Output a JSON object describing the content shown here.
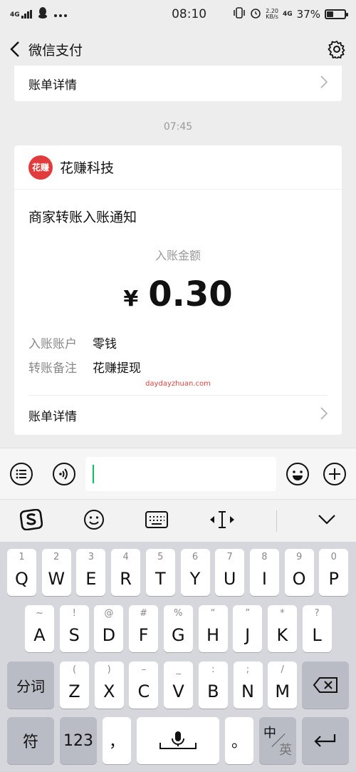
{
  "status_bar": {
    "network": "4G",
    "time": "08:10",
    "speed_top": "2.20",
    "speed_bottom": "KB/s",
    "network_right": "4G",
    "battery": "37%",
    "battery_level": 0.37
  },
  "nav": {
    "title": "微信支付"
  },
  "prev_card": {
    "link_label": "账单详情"
  },
  "timestamp": "07:45",
  "message": {
    "merchant_name": "花赚科技",
    "logo_text": "花赚",
    "notice_title": "商家转账入账通知",
    "amount_label": "入账金额",
    "currency": "¥",
    "amount": "0.30",
    "details": [
      {
        "key": "入账账户",
        "value": "零钱"
      },
      {
        "key": "转账备注",
        "value": "花赚提现"
      }
    ],
    "watermark": "daydayzhuan.com",
    "link_label": "账单详情"
  },
  "keyboard": {
    "row1": [
      {
        "hint": "1",
        "key": "Q"
      },
      {
        "hint": "2",
        "key": "W"
      },
      {
        "hint": "3",
        "key": "E"
      },
      {
        "hint": "4",
        "key": "R"
      },
      {
        "hint": "5",
        "key": "T"
      },
      {
        "hint": "6",
        "key": "Y"
      },
      {
        "hint": "7",
        "key": "U"
      },
      {
        "hint": "8",
        "key": "I"
      },
      {
        "hint": "9",
        "key": "O"
      },
      {
        "hint": "0",
        "key": "P"
      }
    ],
    "row2": [
      {
        "hint": "~",
        "key": "A"
      },
      {
        "hint": "!",
        "key": "S"
      },
      {
        "hint": "@",
        "key": "D"
      },
      {
        "hint": "#",
        "key": "F"
      },
      {
        "hint": "%",
        "key": "G"
      },
      {
        "hint": "“",
        "key": "H"
      },
      {
        "hint": "”",
        "key": "J"
      },
      {
        "hint": "*",
        "key": "K"
      },
      {
        "hint": "?",
        "key": "L"
      }
    ],
    "row3": [
      {
        "hint": "(",
        "key": "Z"
      },
      {
        "hint": ")",
        "key": "X"
      },
      {
        "hint": "–",
        "key": "C"
      },
      {
        "hint": "_",
        "key": "V"
      },
      {
        "hint": ":",
        "key": "B"
      },
      {
        "hint": ";",
        "key": "N"
      },
      {
        "hint": "/",
        "key": "M"
      }
    ],
    "fenci": "分词",
    "symbol": "符",
    "num": "123",
    "comma": "，",
    "period": "。",
    "lang_top": "中",
    "lang_bottom": "英"
  }
}
